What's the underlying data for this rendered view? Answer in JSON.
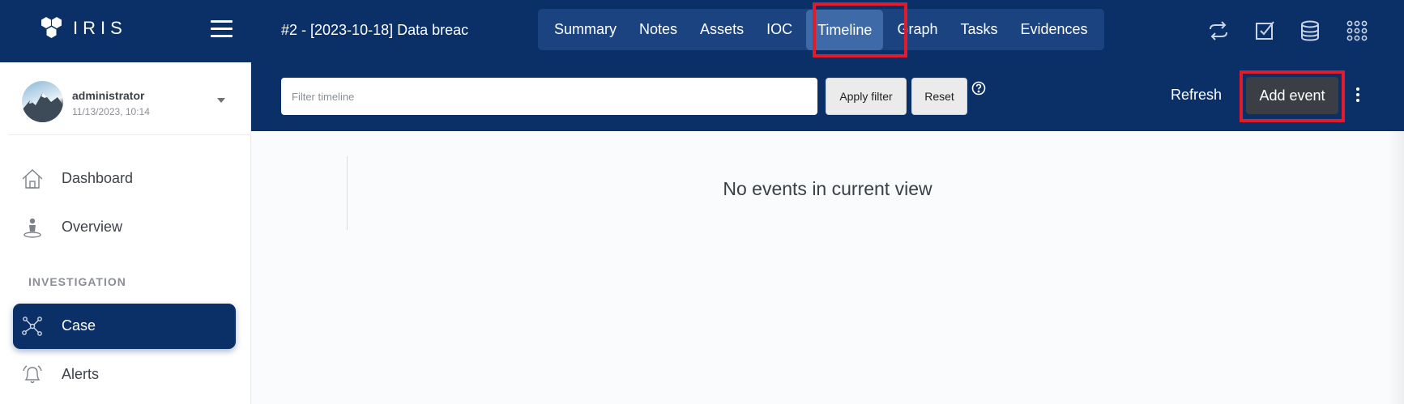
{
  "app": {
    "name": "IRIS"
  },
  "header": {
    "case_title": "#2 - [2023-10-18] Data breac",
    "tabs": [
      {
        "label": "Summary"
      },
      {
        "label": "Notes"
      },
      {
        "label": "Assets"
      },
      {
        "label": "IOC"
      },
      {
        "label": "Timeline",
        "active": true
      },
      {
        "label": "Graph"
      },
      {
        "label": "Tasks"
      },
      {
        "label": "Evidences"
      }
    ],
    "icons": [
      "sync-icon",
      "check-square-icon",
      "database-icon",
      "grid-icon"
    ]
  },
  "sidebar": {
    "user": {
      "name": "administrator",
      "date": "11/13/2023, 10:14"
    },
    "items": [
      {
        "label": "Dashboard",
        "icon": "home-icon"
      },
      {
        "label": "Overview",
        "icon": "person-pin-icon"
      }
    ],
    "section_label": "INVESTIGATION",
    "investigation_items": [
      {
        "label": "Case",
        "icon": "network-icon",
        "active": true
      },
      {
        "label": "Alerts",
        "icon": "bell-icon"
      }
    ]
  },
  "filterbar": {
    "placeholder": "Filter timeline",
    "apply_label": "Apply filter",
    "reset_label": "Reset",
    "refresh_label": "Refresh",
    "add_event_label": "Add event"
  },
  "content": {
    "empty_message": "No events in current view"
  },
  "colors": {
    "navy": "#0b3068",
    "tab_group": "#1b4380",
    "tab_active": "#3f6aa8",
    "highlight": "#e01b2b",
    "add_button": "#3b3f45"
  }
}
